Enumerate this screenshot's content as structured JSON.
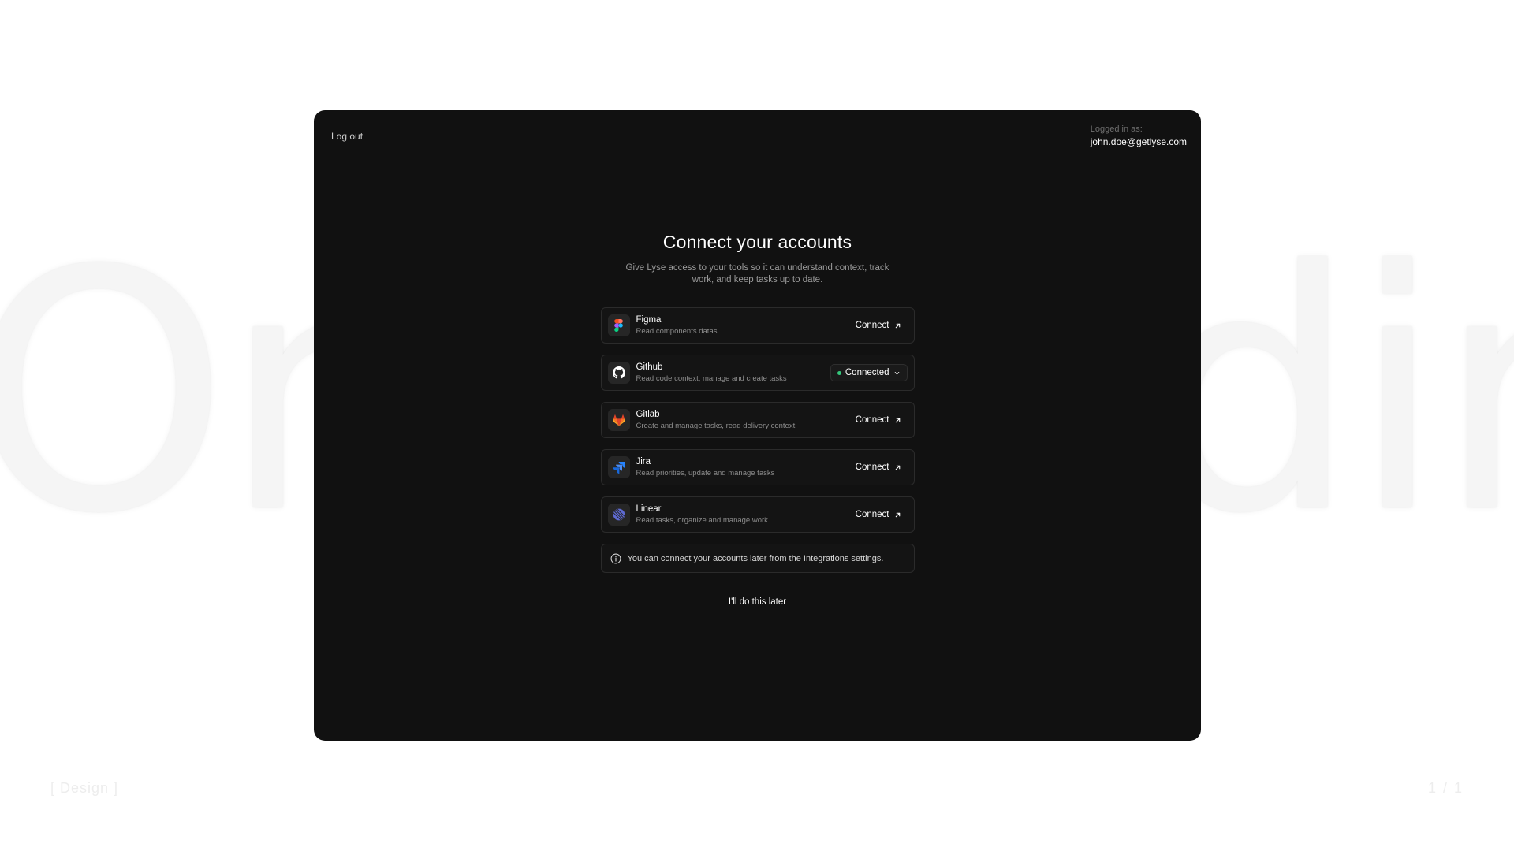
{
  "background": {
    "word": "Onboarding"
  },
  "footer": {
    "left": "[ Design ]",
    "right": "1 / 1"
  },
  "header": {
    "logout_label": "Log out",
    "logged_in_label": "Logged in as:",
    "email": "john.doe@getlyse.com"
  },
  "main": {
    "title": "Connect your accounts",
    "subtitle": "Give Lyse access to your tools so it can understand context, track work, and keep tasks up to date."
  },
  "integrations": [
    {
      "name": "Figma",
      "description": "Read components datas",
      "action": "Connect",
      "icon": "figma-icon"
    },
    {
      "name": "Github",
      "description": "Read code context, manage and create tasks",
      "action": "Connected",
      "icon": "github-icon"
    },
    {
      "name": "Gitlab",
      "description": "Create and manage tasks, read delivery context",
      "action": "Connect",
      "icon": "gitlab-icon"
    },
    {
      "name": "Jira",
      "description": "Read priorities, update and manage tasks",
      "action": "Connect",
      "icon": "jira-icon"
    },
    {
      "name": "Linear",
      "description": "Read tasks, organize and manage work",
      "action": "Connect",
      "icon": "linear-icon"
    }
  ],
  "info": {
    "text": "You can connect your accounts later from the Integrations settings.",
    "icon": "info-icon"
  },
  "skip_label": "I'll do this later",
  "colors": {
    "window_bg": "#111111",
    "connected_dot": "#34c77b",
    "figma_red": "#f24e1e",
    "figma_orange": "#ff7262",
    "figma_purple": "#a259ff",
    "figma_blue": "#1abcfe",
    "figma_green": "#0acf83",
    "gitlab_orange": "#e24329",
    "jira_blue": "#2684ff",
    "linear_indigo": "#5e6ad2"
  }
}
